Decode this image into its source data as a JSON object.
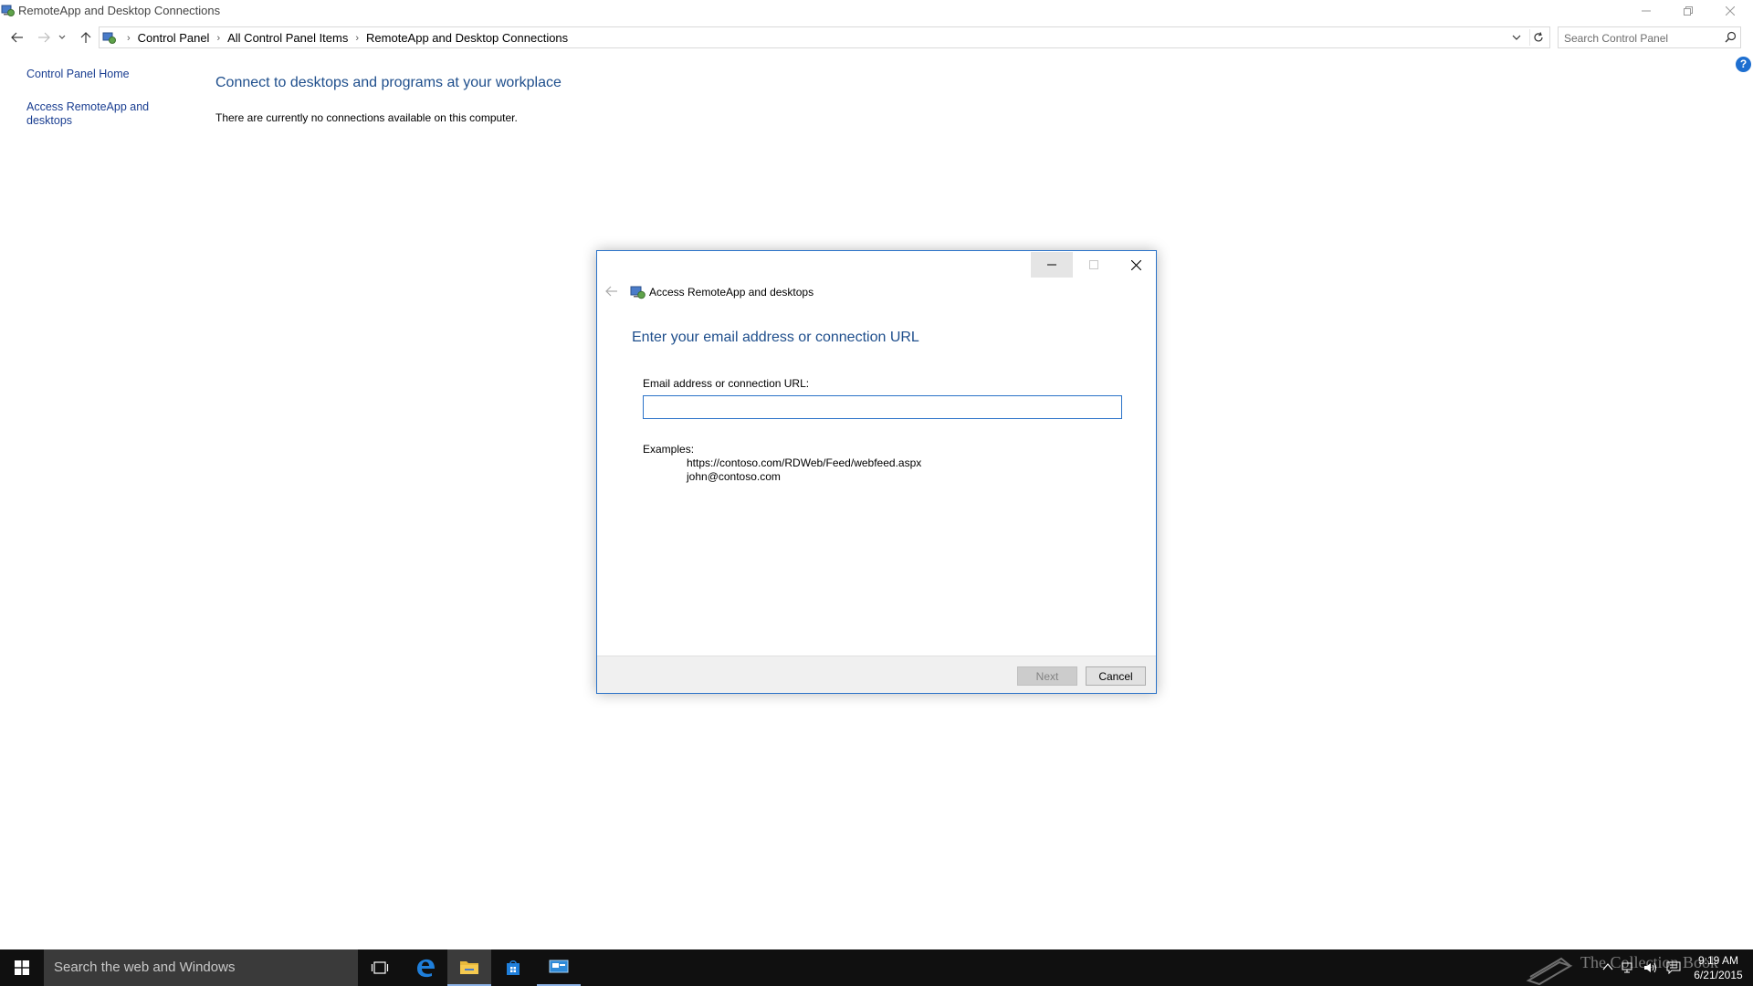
{
  "window": {
    "title": "RemoteApp and Desktop Connections"
  },
  "address": {
    "crumbs": [
      "Control Panel",
      "All Control Panel Items",
      "RemoteApp and Desktop Connections"
    ],
    "search_placeholder": "Search Control Panel"
  },
  "left_pane": {
    "home_link": "Control Panel Home",
    "access_link": "Access RemoteApp and desktops"
  },
  "main": {
    "heading": "Connect to desktops and programs at your workplace",
    "status_text": "There are currently no connections available on this computer."
  },
  "dialog": {
    "title": "Access RemoteApp and desktops",
    "heading": "Enter your email address or connection URL",
    "field_label": "Email address or connection URL:",
    "field_value": "",
    "examples_label": "Examples:",
    "example_url": "https://contoso.com/RDWeb/Feed/webfeed.aspx",
    "example_email": "john@contoso.com",
    "next_label": "Next",
    "cancel_label": "Cancel",
    "next_enabled": false
  },
  "taskbar": {
    "search_placeholder": "Search the web and Windows",
    "apps": [
      "task-view",
      "edge",
      "file-explorer",
      "store",
      "remoteapp-connections"
    ],
    "active_app": "file-explorer",
    "watermark": "The Collection Book",
    "time": "9:19 AM",
    "date": "6/21/2015"
  },
  "colors": {
    "link": "#1a3e91",
    "heading": "#1e4e8c",
    "dialog_border": "#2a72c8",
    "taskbar": "#101010"
  }
}
